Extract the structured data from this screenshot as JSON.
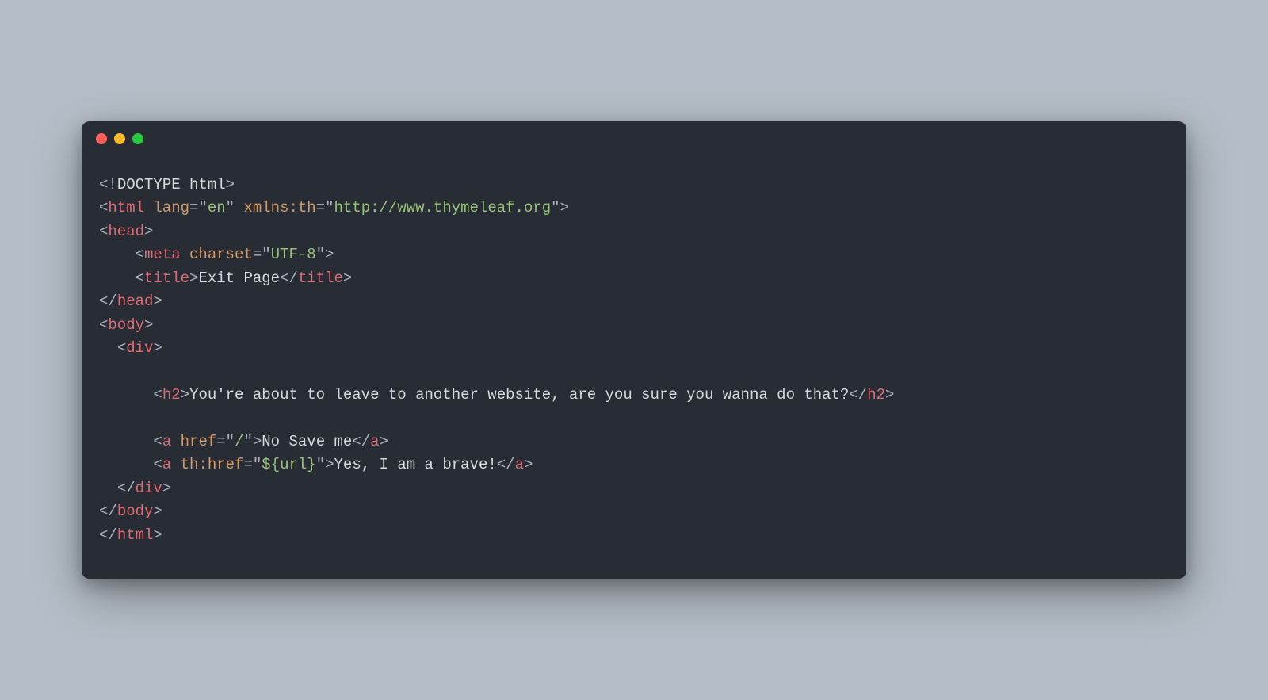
{
  "window": {
    "traffic_lights": [
      "red",
      "yellow",
      "green"
    ]
  },
  "code": {
    "doctype": {
      "open": "<!",
      "name": "DOCTYPE html",
      "close": ">"
    },
    "html_open": {
      "lt": "<",
      "tag": "html",
      "sp1": " ",
      "attr1": "lang",
      "eq1": "=",
      "val1_open": "\"",
      "val1": "en",
      "val1_close": "\"",
      "sp2": " ",
      "attr2": "xmlns:th",
      "eq2": "=",
      "val2_open": "\"",
      "val2": "http://www.thymeleaf.org",
      "val2_close": "\"",
      "gt": ">"
    },
    "head_open": {
      "lt": "<",
      "tag": "head",
      "gt": ">"
    },
    "meta": {
      "indent": "    ",
      "lt": "<",
      "tag": "meta",
      "sp": " ",
      "attr": "charset",
      "eq": "=",
      "vopen": "\"",
      "val": "UTF-8",
      "vclose": "\"",
      "gt": ">"
    },
    "title": {
      "indent": "    ",
      "lt": "<",
      "tag": "title",
      "gt": ">",
      "text": "Exit Page",
      "clt": "</",
      "ctag": "title",
      "cgt": ">"
    },
    "head_close": {
      "lt": "</",
      "tag": "head",
      "gt": ">"
    },
    "body_open": {
      "lt": "<",
      "tag": "body",
      "gt": ">"
    },
    "div_open": {
      "indent": "  ",
      "lt": "<",
      "tag": "div",
      "gt": ">"
    },
    "h2": {
      "indent": "      ",
      "lt": "<",
      "tag": "h2",
      "gt": ">",
      "text": "You're about to leave to another website, are you sure you wanna do that?",
      "clt": "</",
      "ctag": "h2",
      "cgt": ">"
    },
    "a1": {
      "indent": "      ",
      "lt": "<",
      "tag": "a",
      "sp": " ",
      "attr": "href",
      "eq": "=",
      "vopen": "\"",
      "val": "/",
      "vclose": "\"",
      "gt": ">",
      "text": "No Save me",
      "clt": "</",
      "ctag": "a",
      "cgt": ">"
    },
    "a2": {
      "indent": "      ",
      "lt": "<",
      "tag": "a",
      "sp": " ",
      "attr": "th:href",
      "eq": "=",
      "vopen": "\"",
      "val": "${url}",
      "vclose": "\"",
      "gt": ">",
      "text": "Yes, I am a brave!",
      "clt": "</",
      "ctag": "a",
      "cgt": ">"
    },
    "div_close": {
      "indent": "  ",
      "lt": "</",
      "tag": "div",
      "gt": ">"
    },
    "body_close": {
      "lt": "</",
      "tag": "body",
      "gt": ">"
    },
    "html_close": {
      "lt": "</",
      "tag": "html",
      "gt": ">"
    }
  }
}
